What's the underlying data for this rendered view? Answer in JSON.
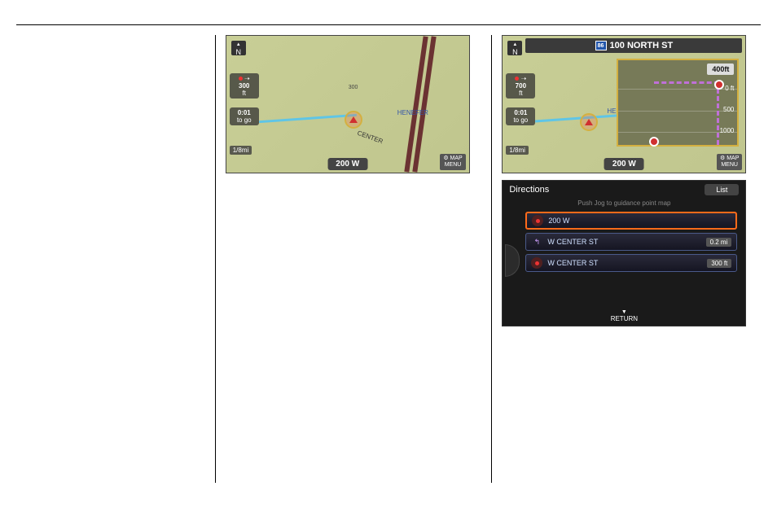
{
  "map1": {
    "compass": "N",
    "dist_box": {
      "value": "300",
      "unit": "ft"
    },
    "time_box": {
      "value": "0:01",
      "label": "to go"
    },
    "scale": "1/8mi",
    "overlay_300": "300",
    "center_label": "CENTER",
    "henefer": "HENEFER",
    "street_bottom": "200 W",
    "map_menu_l1": "MAP",
    "map_menu_l2": "MENU"
  },
  "map2": {
    "compass": "N",
    "title_shield": "86",
    "title": "100 NORTH ST",
    "dist_box": {
      "value": "700",
      "unit": "ft"
    },
    "time_box": {
      "value": "0:01",
      "label": "to go"
    },
    "scale": "1/8mi",
    "inset": {
      "badge": "400ft",
      "t0": "0 ft",
      "t500": "500",
      "t1000": "1000"
    },
    "hen": "HE",
    "street_bottom": "200 W",
    "map_menu_l1": "MAP",
    "map_menu_l2": "MENU"
  },
  "directions": {
    "title": "Directions",
    "tab": "List",
    "subtitle": "Push Jog to guidance point map",
    "rows": [
      {
        "icon": "red",
        "label": "200 W",
        "dist": "",
        "selected": true
      },
      {
        "icon": "arrow",
        "label": "W CENTER ST",
        "dist": "0.2 mi",
        "selected": false
      },
      {
        "icon": "red",
        "label": "W CENTER ST",
        "dist": "300 ft",
        "selected": false
      }
    ],
    "return": "RETURN"
  }
}
